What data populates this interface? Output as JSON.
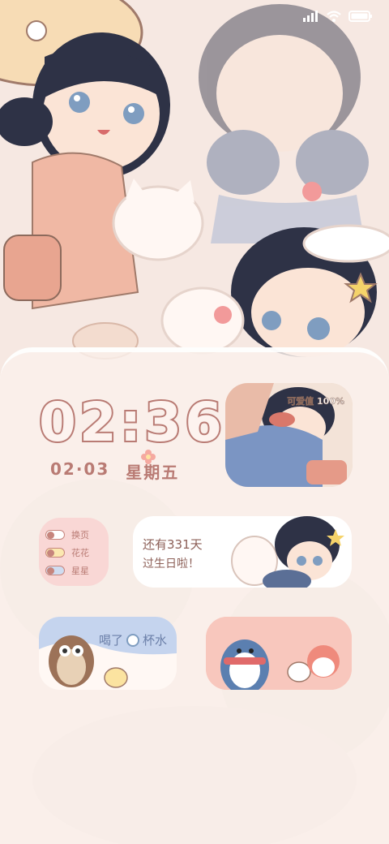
{
  "status_bar": {
    "signal": "signal-icon",
    "wifi": "wifi-icon",
    "battery": "battery-icon"
  },
  "clock": {
    "time": "02:36",
    "date": "02·03",
    "weekday": "星期五"
  },
  "photo_widget": {
    "caption": "可爱值 100%"
  },
  "toggles_widget": {
    "items": [
      {
        "label": "换页"
      },
      {
        "label": "花花"
      },
      {
        "label": "星星"
      }
    ]
  },
  "birthday_widget": {
    "line1": "还有331天",
    "line2": "过生日啦！"
  },
  "water_widget": {
    "prefix": "喝了",
    "count": "0",
    "suffix": "杯水"
  },
  "colors": {
    "accent": "#b97b74",
    "panel": "#faf0ec",
    "pink": "#f9d7d5",
    "blue": "#8fa8cc"
  }
}
